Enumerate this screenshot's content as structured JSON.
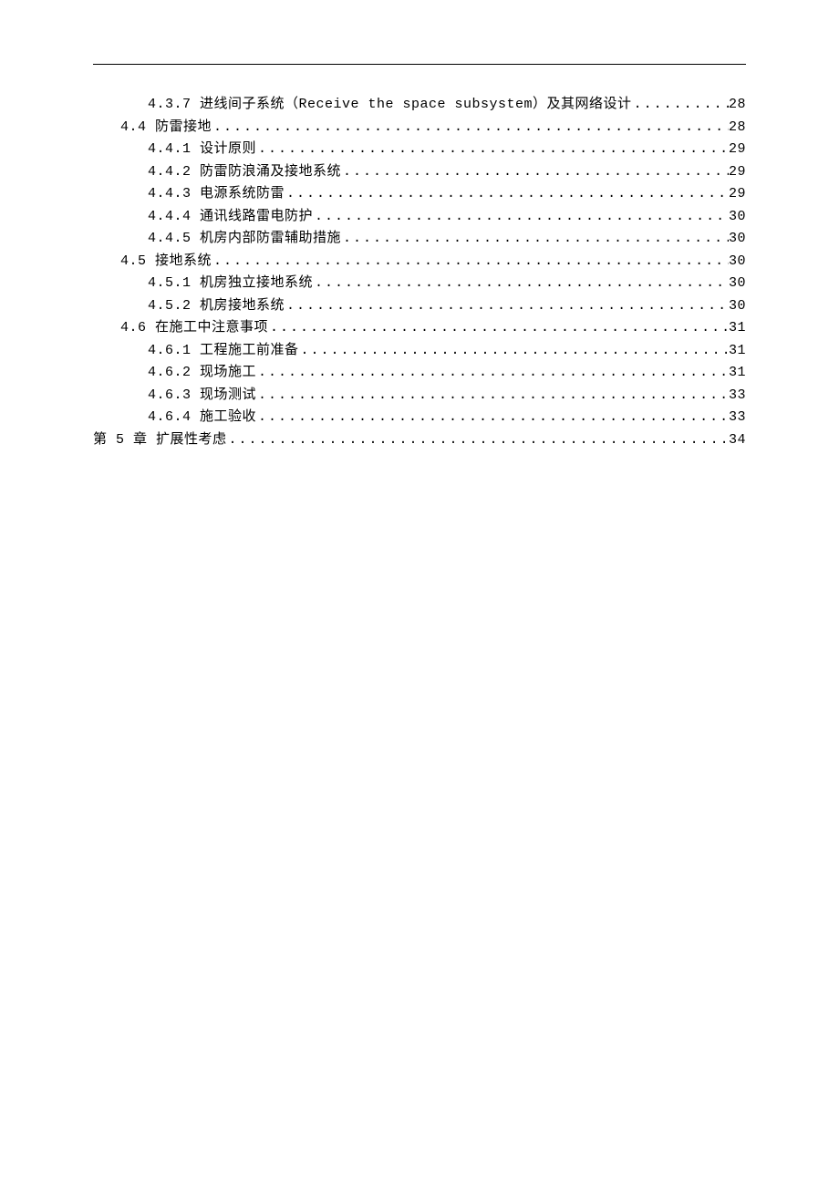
{
  "toc": [
    {
      "level": 3,
      "title": "4.3.7 进线间子系统（Receive the space subsystem）及其网络设计",
      "page": "28"
    },
    {
      "level": 2,
      "title": "4.4 防雷接地",
      "page": "28"
    },
    {
      "level": 3,
      "title": "4.4.1 设计原则",
      "page": "29"
    },
    {
      "level": 3,
      "title": "4.4.2 防雷防浪涌及接地系统",
      "page": "29"
    },
    {
      "level": 3,
      "title": "4.4.3 电源系统防雷",
      "page": "29"
    },
    {
      "level": 3,
      "title": "4.4.4 通讯线路雷电防护",
      "page": "30"
    },
    {
      "level": 3,
      "title": "4.4.5 机房内部防雷辅助措施",
      "page": "30"
    },
    {
      "level": 2,
      "title": "4.5 接地系统",
      "page": "30"
    },
    {
      "level": 3,
      "title": "4.5.1 机房独立接地系统",
      "page": "30"
    },
    {
      "level": 3,
      "title": "4.5.2 机房接地系统",
      "page": "30"
    },
    {
      "level": 2,
      "title": "4.6 在施工中注意事项",
      "page": "31"
    },
    {
      "level": 3,
      "title": "4.6.1 工程施工前准备",
      "page": "31"
    },
    {
      "level": 3,
      "title": "4.6.2 现场施工",
      "page": "31"
    },
    {
      "level": 3,
      "title": "4.6.3 现场测试",
      "page": "33"
    },
    {
      "level": 3,
      "title": "4.6.4 施工验收",
      "page": "33"
    },
    {
      "level": 1,
      "title": "第 5 章 扩展性考虑",
      "page": "34"
    }
  ]
}
